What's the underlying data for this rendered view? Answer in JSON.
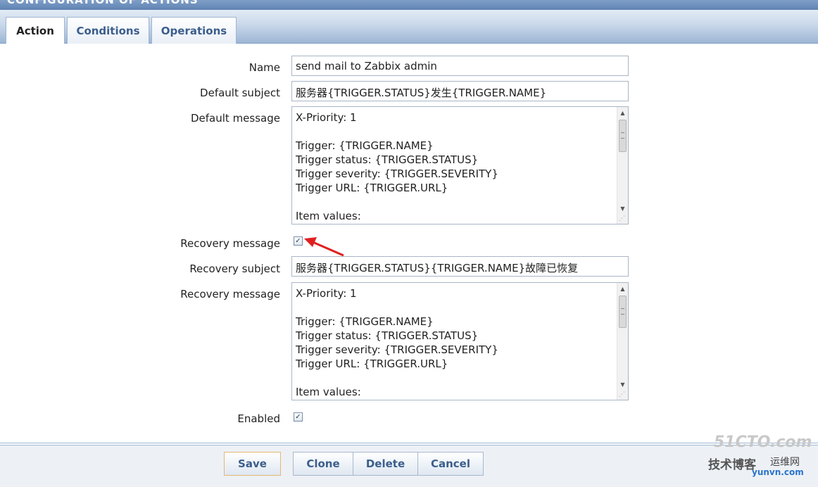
{
  "window": {
    "title": "CONFIGURATION OF ACTIONS"
  },
  "tabs": [
    {
      "label": "Action",
      "active": true
    },
    {
      "label": "Conditions",
      "active": false
    },
    {
      "label": "Operations",
      "active": false
    }
  ],
  "form": {
    "name": {
      "label": "Name",
      "value": "send mail to Zabbix admin"
    },
    "default_subject": {
      "label": "Default subject",
      "value": "服务器{TRIGGER.STATUS}发生{TRIGGER.NAME}"
    },
    "default_message": {
      "label": "Default message",
      "value": "X-Priority: 1\n\nTrigger: {TRIGGER.NAME}\nTrigger status: {TRIGGER.STATUS}\nTrigger severity: {TRIGGER.SEVERITY}\nTrigger URL: {TRIGGER.URL}\n\nItem values:"
    },
    "recovery_message_toggle": {
      "label": "Recovery message",
      "checked": true
    },
    "recovery_subject": {
      "label": "Recovery subject",
      "value": "服务器{TRIGGER.STATUS}{TRIGGER.NAME}故障已恢复"
    },
    "recovery_message": {
      "label": "Recovery message",
      "value": "X-Priority: 1\n\nTrigger: {TRIGGER.NAME}\nTrigger status: {TRIGGER.STATUS}\nTrigger severity: {TRIGGER.SEVERITY}\nTrigger URL: {TRIGGER.URL}\n\nItem values:"
    },
    "enabled": {
      "label": "Enabled",
      "checked": true
    }
  },
  "buttons": {
    "save": "Save",
    "clone": "Clone",
    "delete": "Delete",
    "cancel": "Cancel"
  },
  "colors": {
    "accent": "#3b5e8c",
    "tab_bar": "#9db6d4",
    "annotation_arrow": "#e02020"
  },
  "icons": {
    "checkbox_check": "check-icon",
    "scroll_up": "scroll-up-arrow-icon",
    "scroll_down": "scroll-down-arrow-icon",
    "resize_grip": "resize-grip-icon",
    "annotation": "red-arrow-icon"
  },
  "watermark": {
    "brand": "51CTO.com",
    "tagline": "技术博客",
    "site_name": "运维网",
    "site_url": "yunvn.com"
  }
}
